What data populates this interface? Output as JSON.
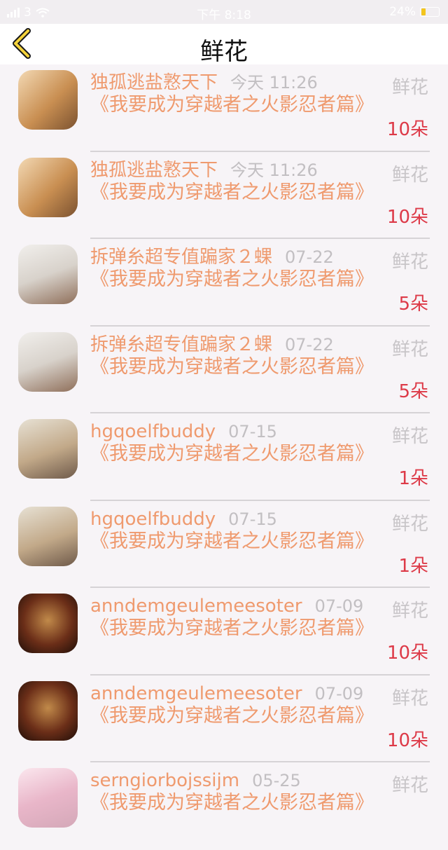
{
  "status": {
    "carrier": "3",
    "time": "下午 8:18",
    "battery": "24%"
  },
  "nav": {
    "title": "鲜花"
  },
  "items": [
    {
      "username": "独孤逃盐憝天下",
      "time": "今天 11:26",
      "title": "《我要成为穿越者之火影忍者篇》",
      "gift": "鲜花",
      "count": "10朵",
      "avatar": "coffee"
    },
    {
      "username": "独孤逃盐憝天下",
      "time": "今天 11:26",
      "title": "《我要成为穿越者之火影忍者篇》",
      "gift": "鲜花",
      "count": "10朵",
      "avatar": "coffee"
    },
    {
      "username": "拆弹糸超专值蹁家２蜾",
      "time": "07-22",
      "title": "《我要成为穿越者之火影忍者篇》",
      "gift": "鲜花",
      "count": "5朵",
      "avatar": "couple"
    },
    {
      "username": "拆弹糸超专值蹁家２蜾",
      "time": "07-22",
      "title": "《我要成为穿越者之火影忍者篇》",
      "gift": "鲜花",
      "count": "5朵",
      "avatar": "couple"
    },
    {
      "username": "hgqoelfbuddy",
      "time": "07-15",
      "title": "《我要成为穿越者之火影忍者篇》",
      "gift": "鲜花",
      "count": "1朵",
      "avatar": "girl"
    },
    {
      "username": "hgqoelfbuddy",
      "time": "07-15",
      "title": "《我要成为穿越者之火影忍者篇》",
      "gift": "鲜花",
      "count": "1朵",
      "avatar": "girl"
    },
    {
      "username": "anndemgeulemeesoter",
      "time": "07-09",
      "title": "《我要成为穿越者之火影忍者篇》",
      "gift": "鲜花",
      "count": "10朵",
      "avatar": "skull"
    },
    {
      "username": "anndemgeulemeesoter",
      "time": "07-09",
      "title": "《我要成为穿越者之火影忍者篇》",
      "gift": "鲜花",
      "count": "10朵",
      "avatar": "skull"
    },
    {
      "username": "serngiorbojssijm",
      "time": "05-25",
      "title": "《我要成为穿越者之火影忍者篇》",
      "gift": "鲜花",
      "count": "",
      "avatar": "candy"
    }
  ]
}
